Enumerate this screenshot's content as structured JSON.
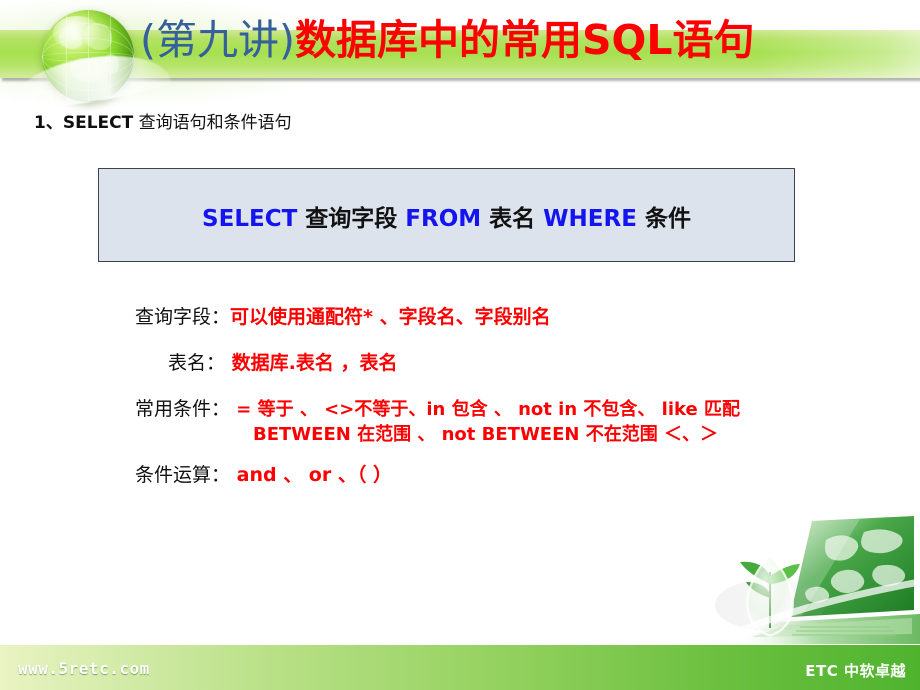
{
  "slide": {
    "title": {
      "lecture": "(第九讲)",
      "subject": "数据库中的常用SQL语句"
    },
    "heading": {
      "number": "1、",
      "keyword": "SELECT",
      "text": " 查询语句和条件语句"
    },
    "syntax_box": {
      "tokens": [
        {
          "text": "SELECT",
          "kind": "keyword"
        },
        {
          "text": "  查询字段 ",
          "kind": "chinese"
        },
        {
          "text": "FROM",
          "kind": "keyword"
        },
        {
          "text": " 表名 ",
          "kind": "chinese"
        },
        {
          "text": "WHERE",
          "kind": "keyword"
        },
        {
          "text": " 条件",
          "kind": "chinese"
        }
      ],
      "full_text": "SELECT  查询字段 FROM 表名 WHERE 条件"
    },
    "explanations": [
      {
        "label": "查询字段：",
        "value": "可以使用通配符* 、字段名、字段别名"
      },
      {
        "label": "表名：",
        "value": " 数据库.表名 ，表名"
      },
      {
        "label": "常用条件：",
        "value": " = 等于 、 <>不等于、in 包含 、 not in 不包含、 like 匹配"
      },
      {
        "label": "",
        "value": "BETWEEN  在范围 、 not BETWEEN  不在范围 ＜、＞"
      },
      {
        "label": "条件运算：",
        "value": "  and 、 or 、（ ）"
      }
    ],
    "footer": {
      "website": "www.5retc.com",
      "brand": "ETC 中软卓越"
    },
    "colors": {
      "title_blue": "#36609b",
      "title_red": "#fb0101",
      "keyword_blue": "#1414f0",
      "value_red": "#fb0101",
      "band_green": "#a6e04f",
      "box_fill": "#dce3ec",
      "box_border": "#3b4250"
    }
  }
}
